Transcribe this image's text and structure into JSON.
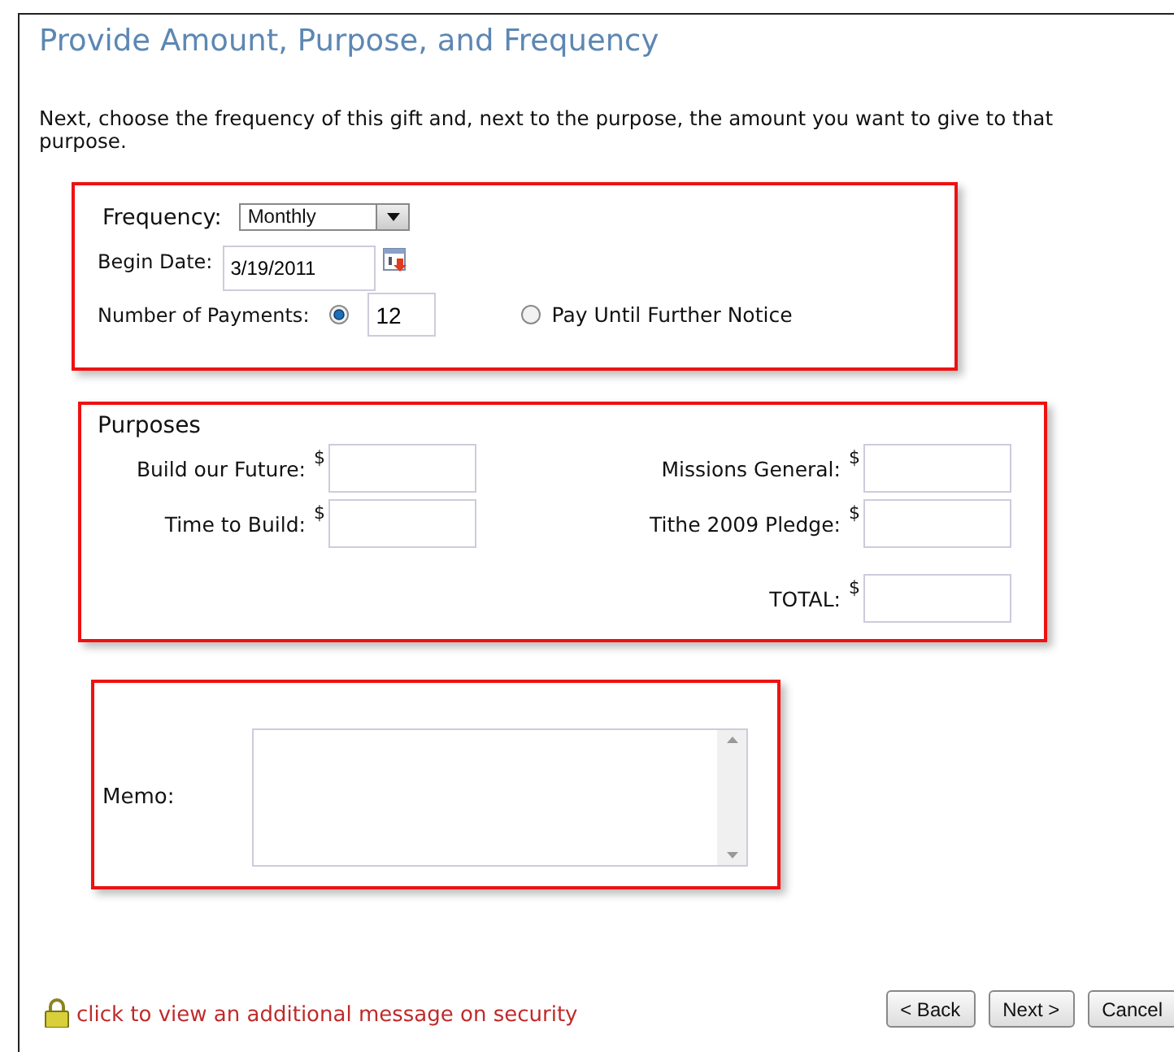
{
  "title": "Provide Amount, Purpose, and Frequency",
  "intro": "Next, choose the frequency of this gift and, next to the purpose, the amount you want to give to that purpose.",
  "frequency": {
    "label": "Frequency:",
    "value": "Monthly"
  },
  "begin_date": {
    "label": "Begin Date:",
    "value": "3/19/2011"
  },
  "payments": {
    "label": "Number of Payments:",
    "options": [
      {
        "kind": "count",
        "selected": true,
        "value": "12"
      },
      {
        "kind": "until",
        "selected": false,
        "label": "Pay Until Further Notice"
      }
    ]
  },
  "purposes": {
    "heading": "Purposes",
    "items": [
      {
        "label": "Build our Future:",
        "currency": "$"
      },
      {
        "label": "Missions General:",
        "currency": "$"
      },
      {
        "label": "Time to Build:",
        "currency": "$"
      },
      {
        "label": "Tithe 2009 Pledge:",
        "currency": "$"
      }
    ],
    "total": {
      "label": "TOTAL:",
      "currency": "$"
    }
  },
  "memo": {
    "label": "Memo:"
  },
  "security_link": "click to view an additional message on security",
  "buttons": [
    "< Back",
    "Next >",
    "Cancel"
  ]
}
